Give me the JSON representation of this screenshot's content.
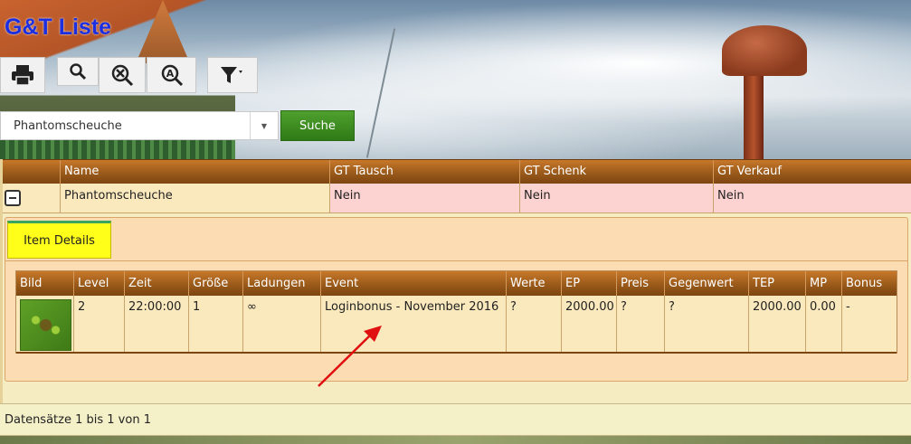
{
  "header": {
    "title": "G&T Liste"
  },
  "toolbar": {
    "buttons": [
      {
        "icon": "printer-icon"
      },
      {
        "icon": "search-icon"
      },
      {
        "icon": "clear-search-icon"
      },
      {
        "icon": "advanced-search-icon"
      },
      {
        "icon": "filter-icon"
      }
    ]
  },
  "search": {
    "value": "Phantomscheuche",
    "button_label": "Suche"
  },
  "grid": {
    "columns": [
      "",
      "Name",
      "GT Tausch",
      "GT Schenk",
      "GT Verkauf"
    ],
    "row": {
      "name": "Phantomscheuche",
      "gt_tausch": "Nein",
      "gt_schenk": "Nein",
      "gt_verkauf": "Nein"
    }
  },
  "details": {
    "tab_label": "Item Details",
    "columns": [
      "Bild",
      "Level",
      "Zeit",
      "Größe",
      "Ladungen",
      "Event",
      "Werte",
      "EP",
      "Preis",
      "Gegenwert",
      "TEP",
      "MP",
      "Bonus"
    ],
    "row": {
      "level": "2",
      "zeit": "22:00:00",
      "groesse": "1",
      "ladungen": "∞",
      "event": "Loginbonus - November 2016",
      "werte": "?",
      "ep": "2000.00",
      "preis": "?",
      "gegenwert": "?",
      "tep": "2000.00",
      "mp": "0.00",
      "bonus": "-"
    }
  },
  "footer": {
    "records_text": "Datensätze 1 bis 1 von 1"
  },
  "colors": {
    "title": "#1b2ee0",
    "header_brown": "#9a5a1a",
    "row_light": "#f9e9bd",
    "row_pink": "#fcd3d1",
    "tab_yellow": "#ffff1a",
    "search_green": "#3f8c22",
    "arrow_red": "#e01010"
  }
}
